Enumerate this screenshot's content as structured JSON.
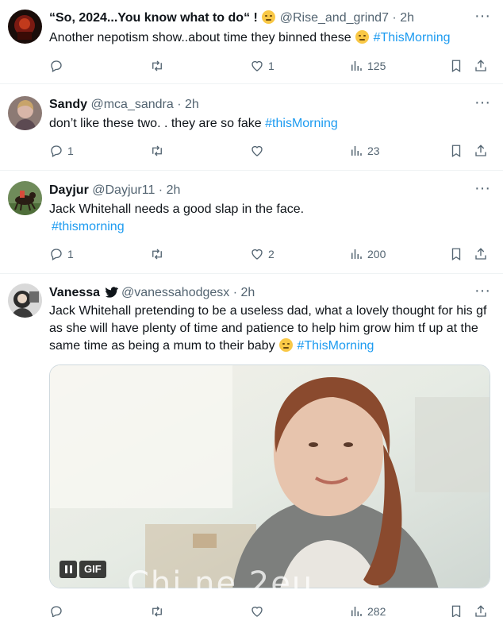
{
  "tweets": [
    {
      "name": "“So, 2024...You know what to do“ !",
      "name_emoji": "relieved-face-emoji",
      "handle": "@Rise_and_grind7",
      "dot": "·",
      "time": "2h",
      "text": "Another nepotism show..about time they binned these",
      "text_emoji": "slightly-frowning-face-emoji",
      "hashtag": "#ThisMorning",
      "replies": "",
      "retweets": "",
      "likes": "1",
      "views": "125"
    },
    {
      "name": "Sandy",
      "handle": "@mca_sandra",
      "dot": "·",
      "time": "2h",
      "text": "don’t like these two. . they are so fake",
      "hashtag": "#thisMorning",
      "replies": "1",
      "retweets": "",
      "likes": "",
      "views": "23"
    },
    {
      "name": "Dayjur",
      "handle": "@Dayjur11",
      "dot": "·",
      "time": "2h",
      "text": "Jack Whitehall needs a good slap in the face.",
      "hashtag": "#thismorning",
      "replies": "1",
      "retweets": "",
      "likes": "2",
      "views": "200"
    },
    {
      "name": "Vanessa",
      "handle": "@vanessahodgesx",
      "dot": "·",
      "time": "2h",
      "text": "Jack Whitehall pretending to be a useless dad, what a lovely thought for his gf as she will have plenty of time and patience to help him grow him tf up at the same time as being a mum to their baby",
      "text_emoji": "slightly-frowning-face-emoji",
      "hashtag": "#ThisMorning",
      "gif_label": "GIF",
      "replies": "",
      "retweets": "",
      "likes": "",
      "views": "282"
    }
  ],
  "watermark": "Chi   ne 2eu",
  "colors": {
    "accent": "#1d9bf0",
    "secondary_text": "#536471",
    "divider": "#eff3f4"
  }
}
